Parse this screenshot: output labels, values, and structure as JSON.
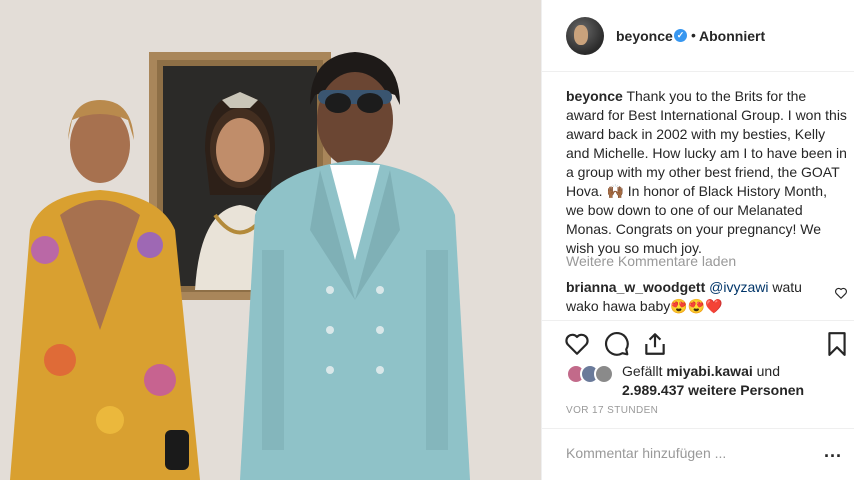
{
  "post": {
    "username": "beyonce",
    "follow_status": "Abonniert",
    "caption_user": "beyonce",
    "caption_text": "Thank you to the Brits for the award for Best International Group. I won this award back in 2002 with my besties, Kelly and Michelle. How lucky am I to have been in a group with my other best friend, the GOAT Hova. 🙌🏾 In honor of Black History Month, we bow down to one of our Melanated Monas. Congrats on your pregnancy! We wish you so much joy.",
    "load_more_comments": "Weitere Kommentare laden",
    "comment": {
      "user": "brianna_w_woodgett",
      "mention": "@ivyzawi",
      "text": "watu wako hawa baby😍😍❤️"
    },
    "likes": {
      "prefix": "Gefällt",
      "liker": "miyabi.kawai",
      "conjunction": "und",
      "others": "2.989.437 weitere Personen"
    },
    "timestamp": "VOR 17 STUNDEN",
    "add_comment_placeholder": "Kommentar hinzufügen ...",
    "more_options": "..."
  },
  "icons": {
    "verified": "verified-badge-icon",
    "heart": "heart-icon",
    "comment": "comment-icon",
    "share": "share-icon",
    "save": "bookmark-icon"
  },
  "colors": {
    "verified": "#3897f0",
    "muted": "#999999",
    "text": "#262626",
    "heart_small": "#ed4956"
  }
}
